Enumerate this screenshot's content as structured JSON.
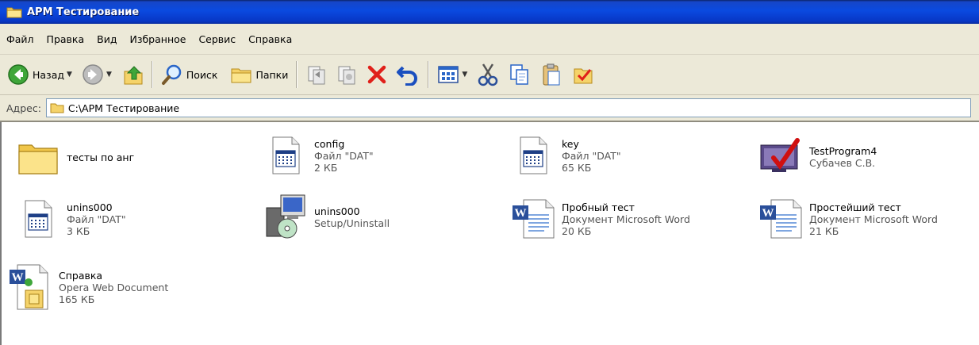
{
  "window": {
    "title": "АРМ Тестирование"
  },
  "menu": [
    "Файл",
    "Правка",
    "Вид",
    "Избранное",
    "Сервис",
    "Справка"
  ],
  "toolbar": {
    "back_label": "Назад",
    "search_label": "Поиск",
    "folders_label": "Папки"
  },
  "address": {
    "label": "Адрес:",
    "path": "C:\\АРМ Тестирование"
  },
  "items": [
    {
      "name": "тесты по анг",
      "type": "",
      "size": "",
      "icon": "folder-icon"
    },
    {
      "name": "config",
      "type": "Файл \"DAT\"",
      "size": "2 КБ",
      "icon": "dat-file-icon"
    },
    {
      "name": "key",
      "type": "Файл \"DAT\"",
      "size": "65 КБ",
      "icon": "dat-file-icon"
    },
    {
      "name": "TestProgram4",
      "type": "Субачев С.В.",
      "size": "",
      "icon": "app-icon"
    },
    {
      "name": "unins000",
      "type": "Файл \"DAT\"",
      "size": "3 КБ",
      "icon": "dat-file-icon"
    },
    {
      "name": "unins000",
      "type": "Setup/Uninstall",
      "size": "",
      "icon": "setup-icon"
    },
    {
      "name": "Пробный тест",
      "type": "Документ Microsoft Word",
      "size": "20 КБ",
      "icon": "word-document-icon"
    },
    {
      "name": "Простейший тест",
      "type": "Документ Microsoft Word",
      "size": "21 КБ",
      "icon": "word-document-icon"
    },
    {
      "name": "Справка",
      "type": "Opera Web Document",
      "size": "165 КБ",
      "icon": "web-document-icon"
    }
  ]
}
